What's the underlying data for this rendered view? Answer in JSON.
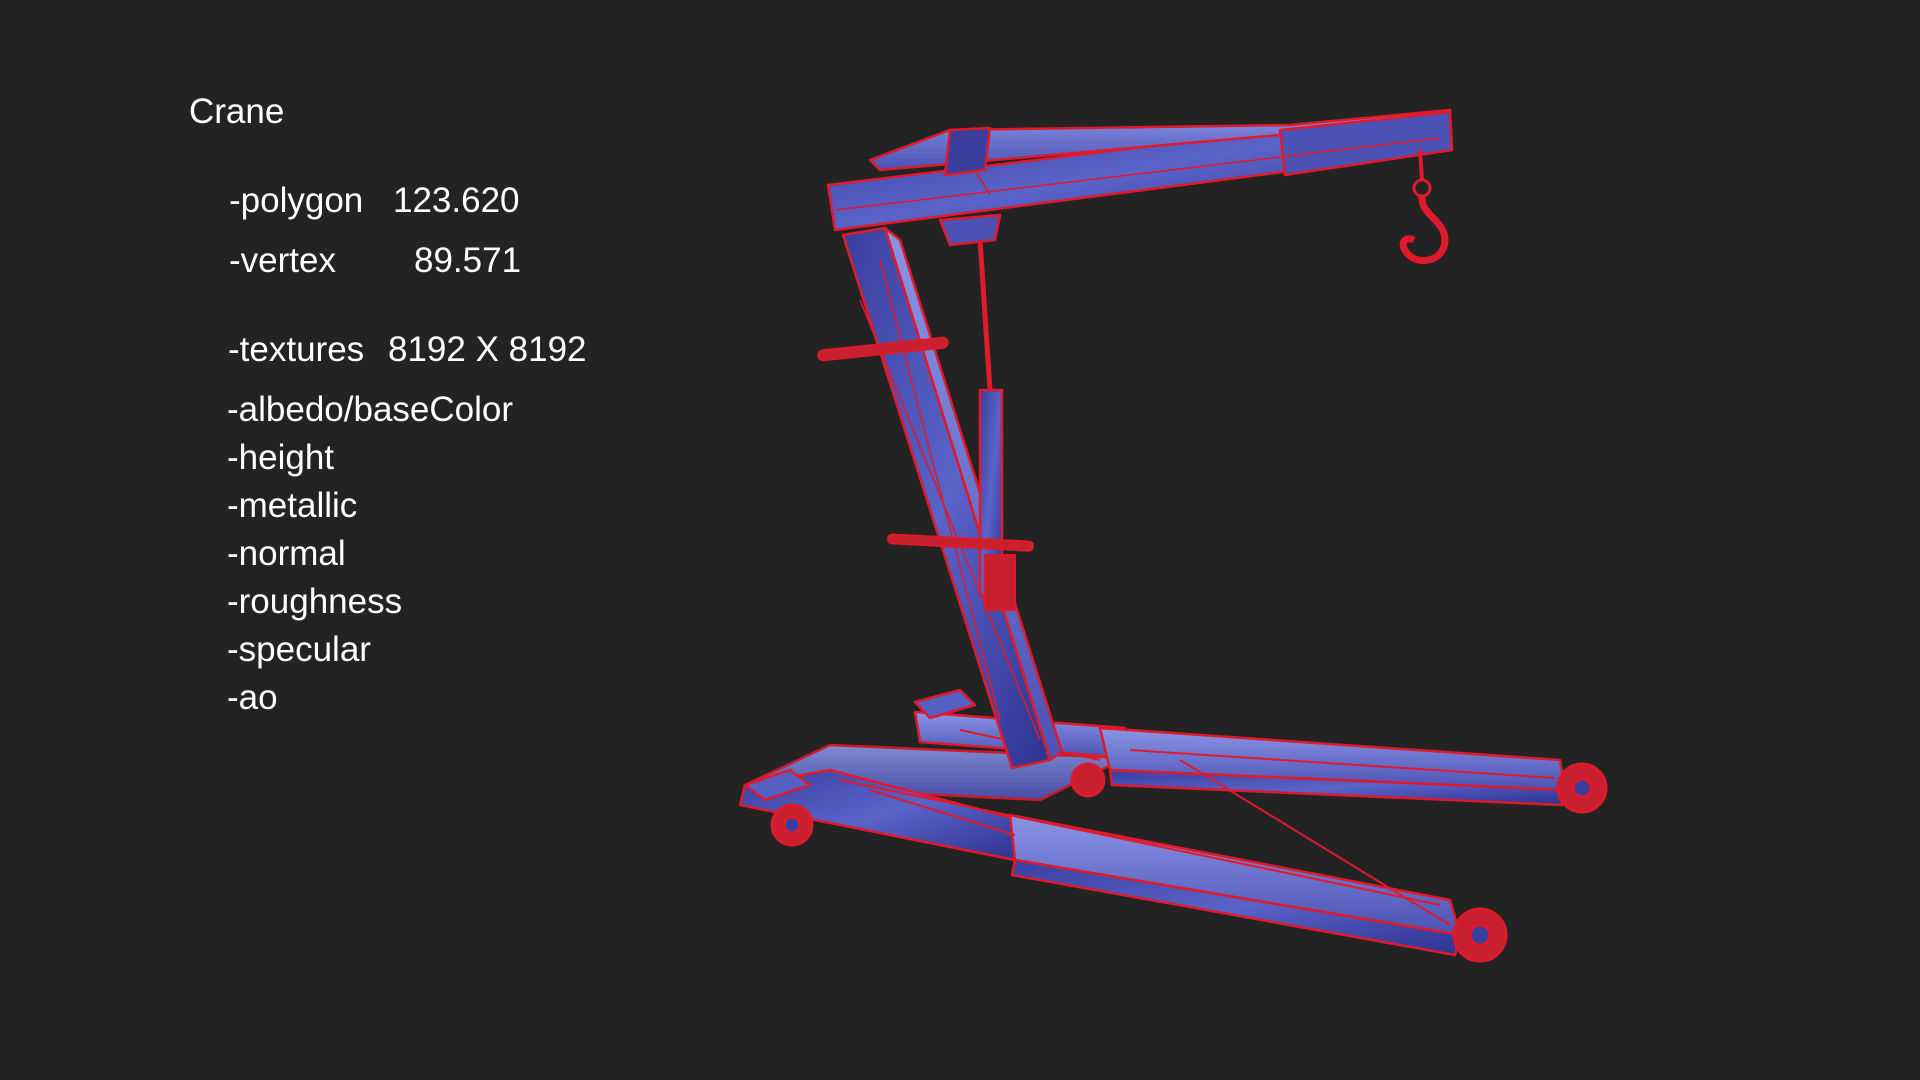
{
  "title": "Crane",
  "stats": {
    "polygon": {
      "label": "-polygon",
      "value": "123.620"
    },
    "vertex": {
      "label": "-vertex",
      "value": "89.571"
    },
    "textures": {
      "label": "-textures",
      "value": "8192 X 8192"
    }
  },
  "texture_maps": [
    "-albedo/baseColor",
    "-height",
    "-metallic",
    "-normal",
    "-roughness",
    "-specular",
    "-ao"
  ],
  "render": {
    "subject": "engine-crane-wireframe",
    "colors": {
      "background": "#232323",
      "wire": "#e01a2a",
      "surface": "#3a3f9e",
      "surface_highlight": "#7d88e0"
    }
  }
}
